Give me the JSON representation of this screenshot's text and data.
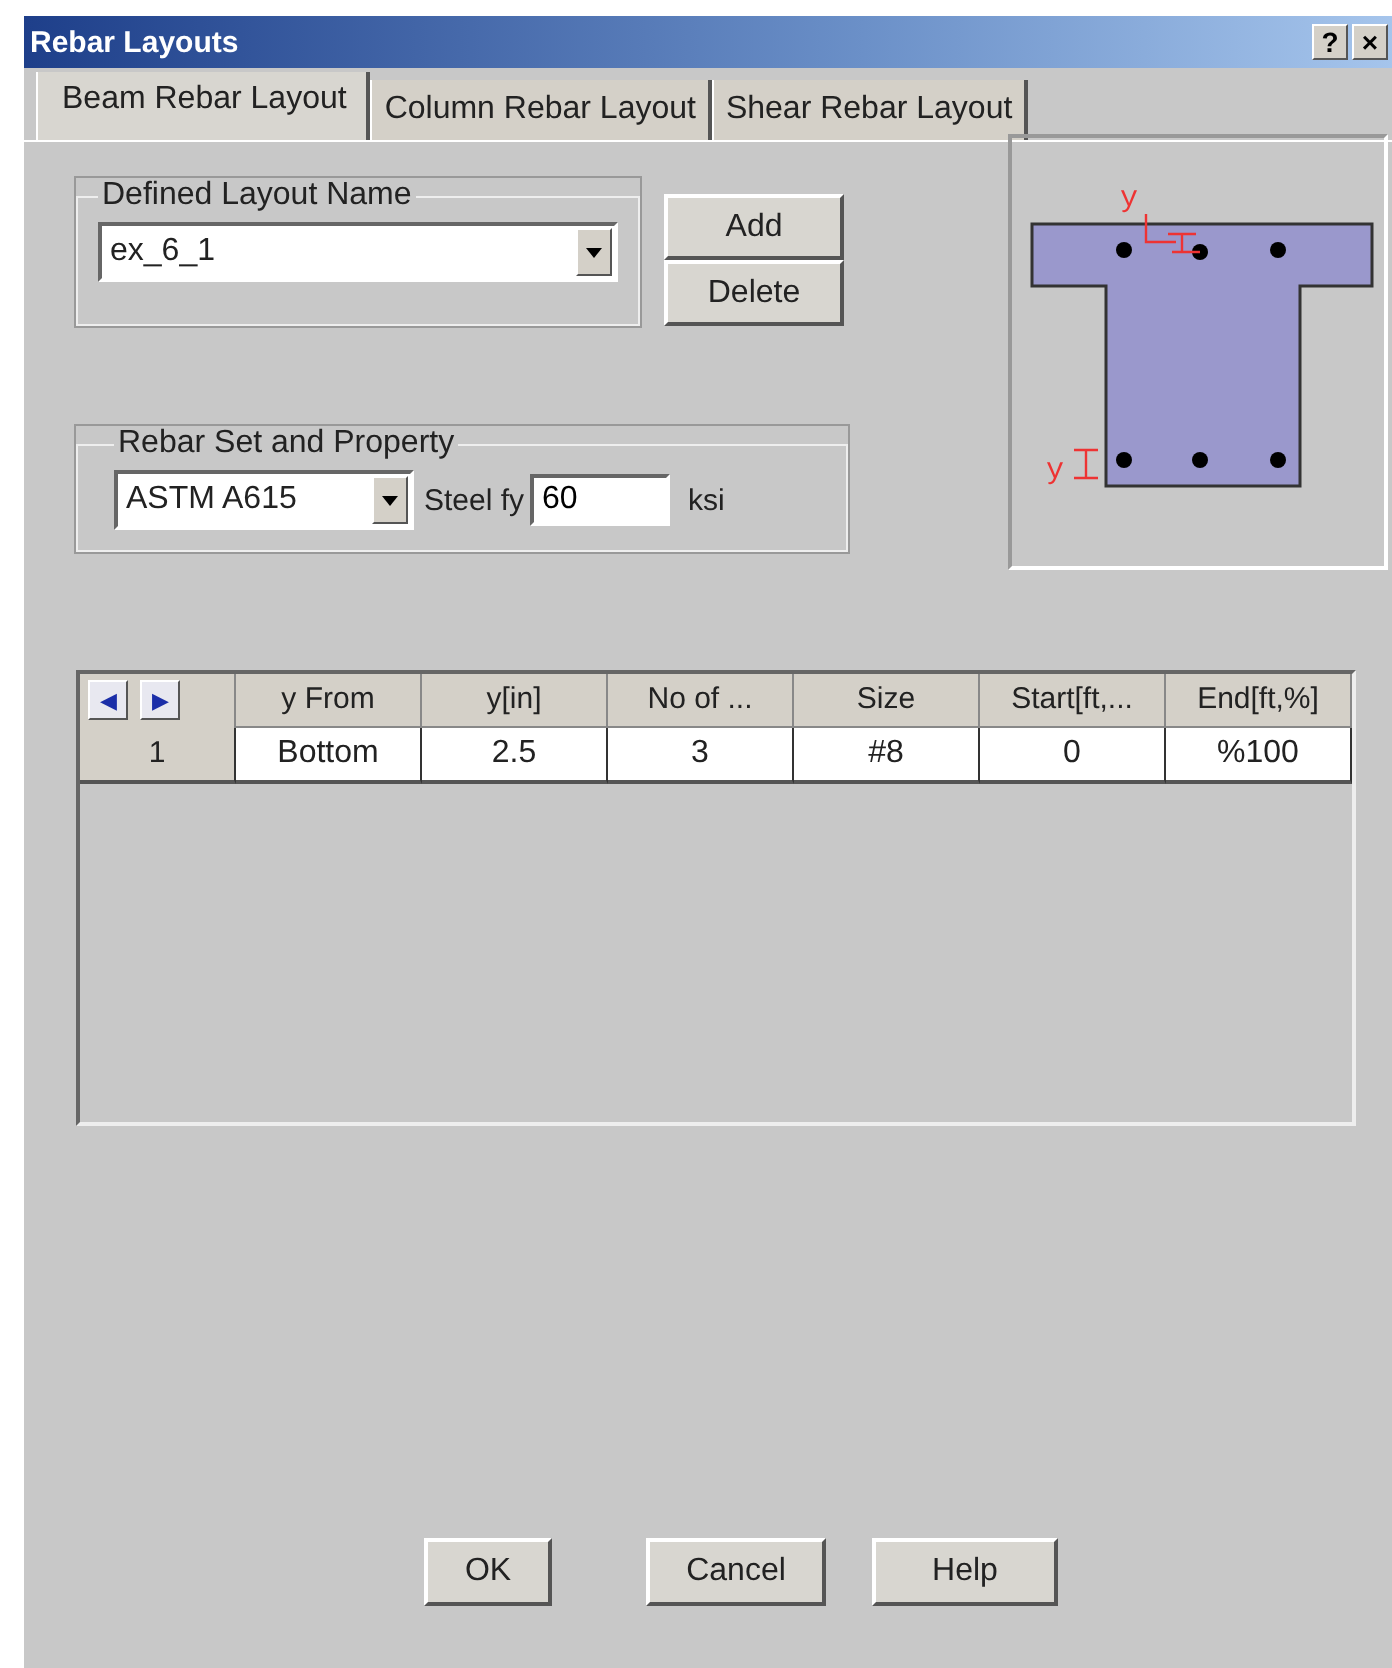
{
  "window": {
    "title": "Rebar Layouts",
    "title_buttons": [
      "?",
      "×"
    ]
  },
  "tabs": [
    {
      "label": "Beam Rebar Layout",
      "selected": true
    },
    {
      "label": "Column Rebar Layout",
      "selected": false
    },
    {
      "label": "Shear Rebar Layout",
      "selected": false
    }
  ],
  "layout_group": {
    "title": "Defined Layout Name",
    "value": "ex_6_1",
    "buttons": [
      "Add",
      "Delete"
    ]
  },
  "rebar_group": {
    "title": "Rebar Set and Property",
    "rebar_set": "ASTM A615",
    "fy_label": "Steel fy",
    "fy_value": "60",
    "fy_unit": "ksi"
  },
  "diagram": {
    "labels": [
      "y",
      "y"
    ]
  },
  "table": {
    "nav": [
      "◀",
      "▶"
    ],
    "columns": [
      "y From",
      "y[in]",
      "No of ...",
      "Size",
      "Start[ft,...",
      "End[ft,%]"
    ],
    "rows": [
      {
        "number": "1",
        "cells": [
          "Bottom",
          "2.5",
          "3",
          "#8",
          "0",
          "%100"
        ]
      }
    ]
  },
  "buttons": [
    "OK",
    "Cancel",
    "Help"
  ]
}
